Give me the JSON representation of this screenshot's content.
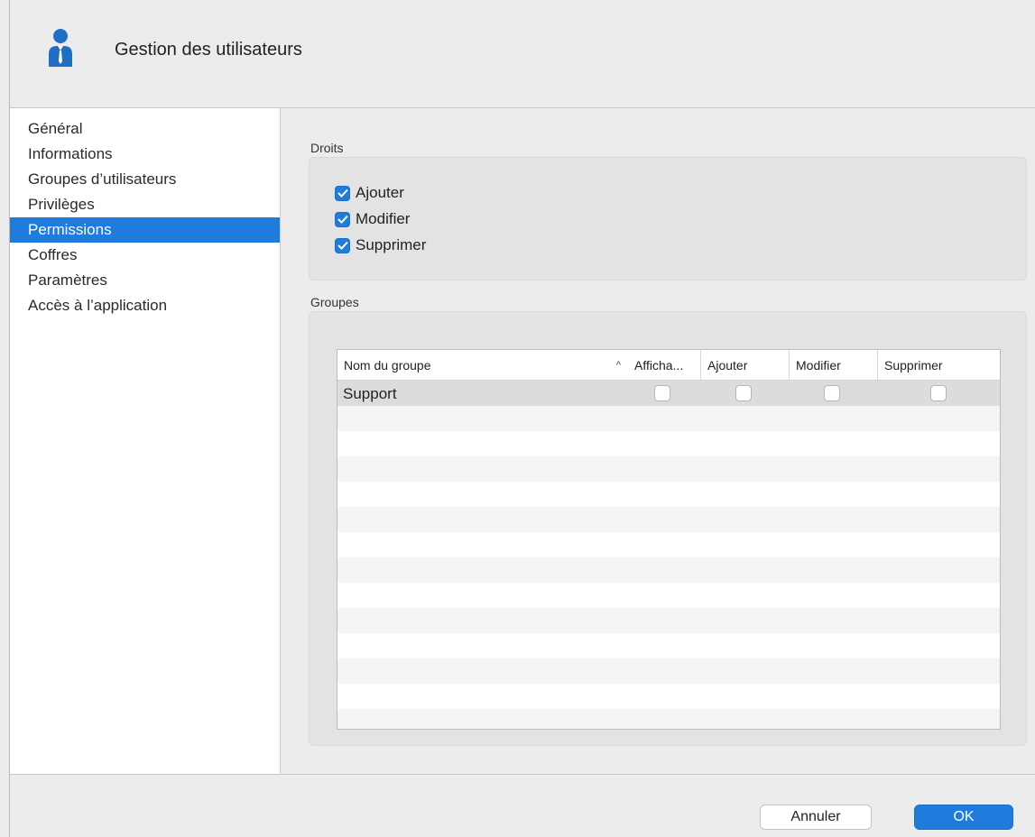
{
  "window": {
    "title": "Gestion des utilisateurs",
    "icon": "user-icon",
    "accent_color": "#1f7bdc"
  },
  "sidebar": {
    "items": [
      {
        "label": "Général"
      },
      {
        "label": "Informations"
      },
      {
        "label": "Groupes d’utilisateurs"
      },
      {
        "label": "Privilèges"
      },
      {
        "label": "Permissions",
        "selected": true
      },
      {
        "label": "Coffres"
      },
      {
        "label": "Paramètres"
      },
      {
        "label": "Accès à l’application"
      }
    ]
  },
  "rights": {
    "label": "Droits",
    "options": [
      {
        "label": "Ajouter",
        "checked": true
      },
      {
        "label": "Modifier",
        "checked": true
      },
      {
        "label": "Supprimer",
        "checked": true
      }
    ]
  },
  "groups": {
    "label": "Groupes",
    "columns": [
      "Nom du groupe",
      "Afficha...",
      "Ajouter",
      "Modifier",
      "Supprimer"
    ],
    "sort_icon": "chevron-up-icon",
    "rows": [
      {
        "name": "Support",
        "afficher": false,
        "ajouter": false,
        "modifier": false,
        "supprimer": false
      }
    ]
  },
  "buttons": {
    "cancel": "Annuler",
    "ok": "OK"
  }
}
